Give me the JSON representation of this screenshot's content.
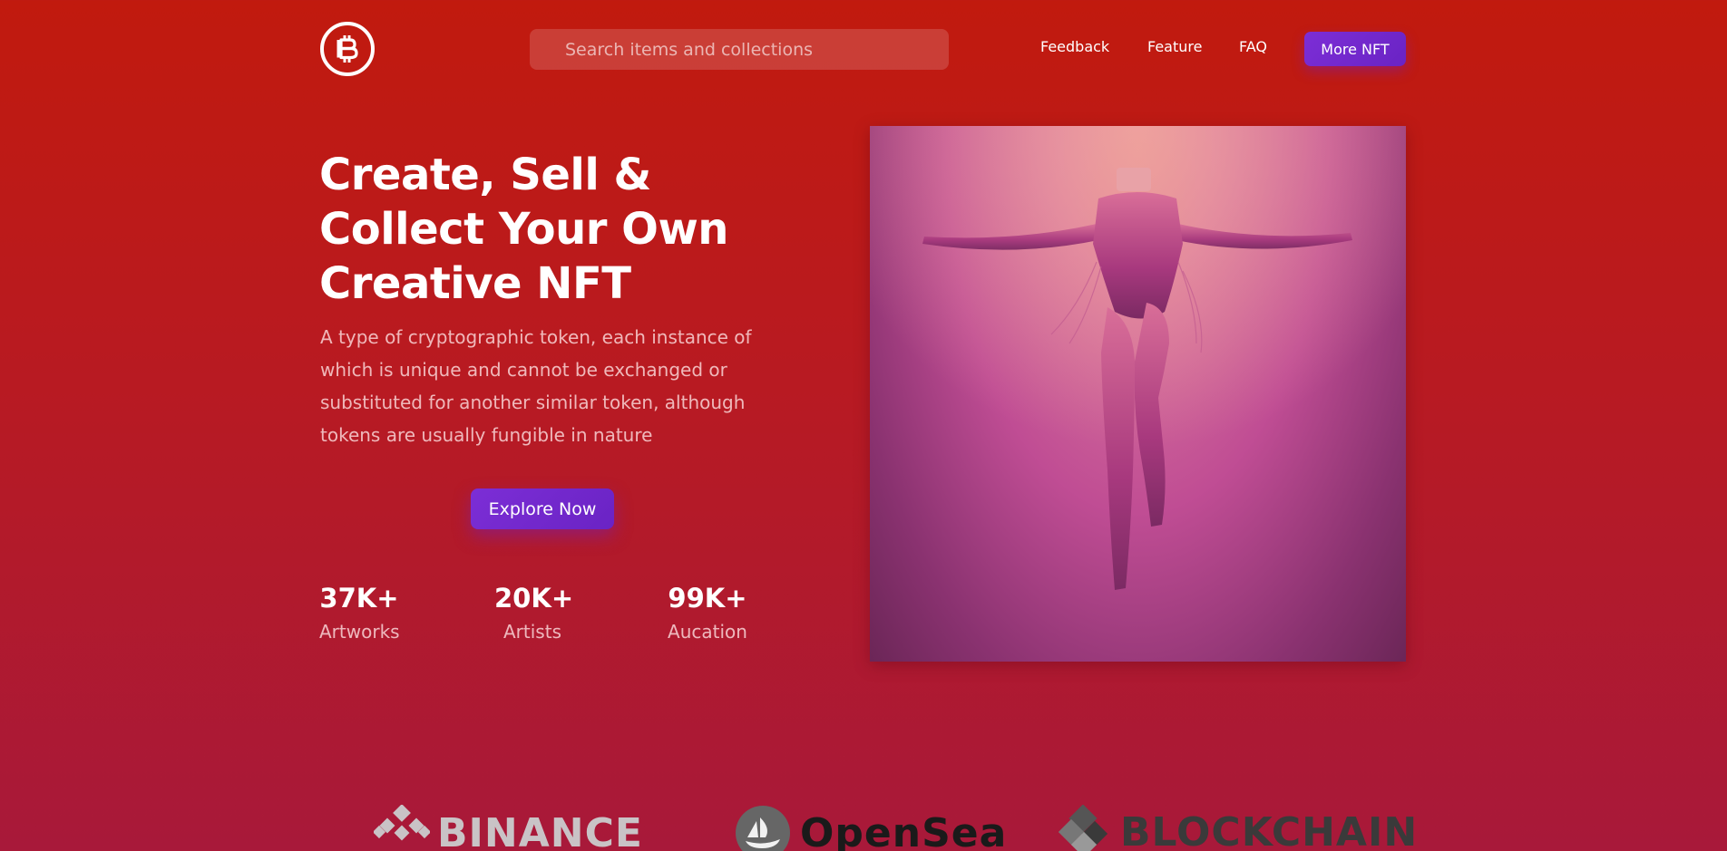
{
  "header": {
    "logo_icon": "bitcoin-icon",
    "search": {
      "placeholder": "Search items and collections",
      "value": ""
    },
    "nav": [
      {
        "label": "Feedback"
      },
      {
        "label": "Feature"
      },
      {
        "label": "FAQ"
      }
    ],
    "more_button": "More NFT"
  },
  "hero": {
    "title_lines": [
      "Create, Sell &",
      "Collect Your Own",
      "Creative NFT"
    ],
    "description": "A type of cryptographic token, each instance of which is unique and cannot be exchanged or substituted for another similar token, although tokens are usually fungible in nature",
    "cta": "Explore Now",
    "stats": [
      {
        "value": "37K+",
        "label": "Artworks"
      },
      {
        "value": "20K+",
        "label": "Artists"
      },
      {
        "value": "99K+",
        "label": "Aucation"
      }
    ]
  },
  "partners": [
    {
      "name": "BINANCE",
      "icon": "binance-icon",
      "color": "#c9c3c6"
    },
    {
      "name": "OpenSea",
      "icon": "opensea-icon",
      "color": "#1a1a1a"
    },
    {
      "name": "BLOCKCHAIN",
      "icon": "blockchain-icon",
      "color": "#3a3a3a"
    }
  ],
  "colors": {
    "accent": "#7c2ed6",
    "background_top": "#c11a0e",
    "background_bottom": "#a8193a"
  }
}
